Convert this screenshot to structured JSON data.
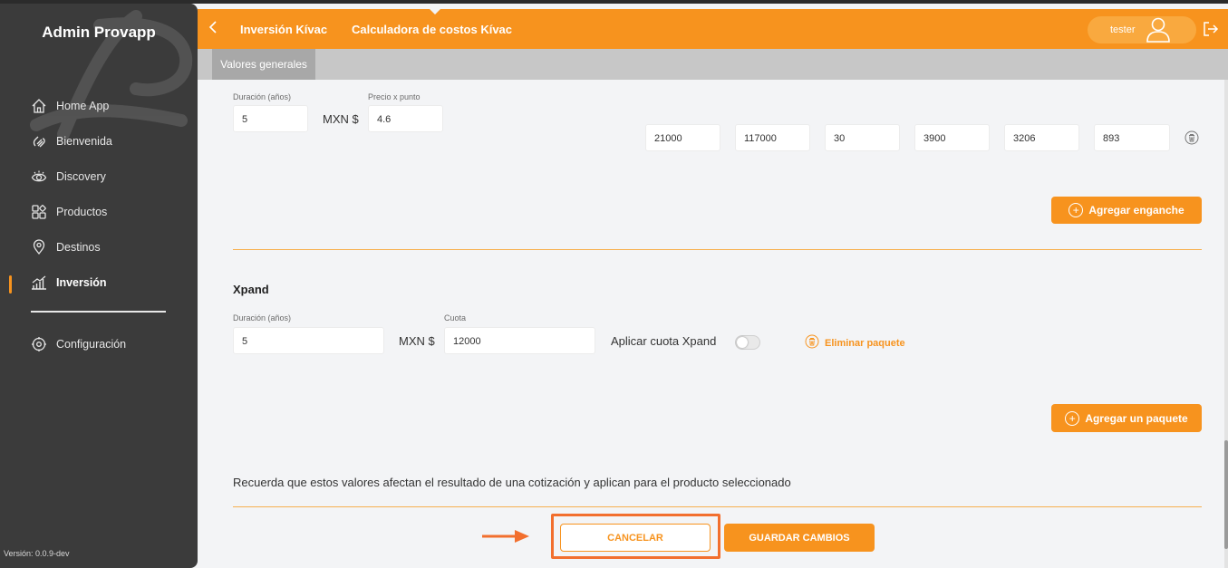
{
  "sidebar": {
    "brand": "Admin Provapp",
    "items": [
      {
        "label": "Home App",
        "icon": "home-icon"
      },
      {
        "label": "Bienvenida",
        "icon": "wave-hand-icon"
      },
      {
        "label": "Discovery",
        "icon": "eye-icon"
      },
      {
        "label": "Productos",
        "icon": "grid-icon"
      },
      {
        "label": "Destinos",
        "icon": "location-pin-icon"
      },
      {
        "label": "Inversión",
        "icon": "bar-chart-icon",
        "active": true
      }
    ],
    "settings": {
      "label": "Configuración",
      "icon": "gear-icon"
    },
    "version": "Versión: 0.0.9-dev"
  },
  "header": {
    "back_icon": "chevron-left-icon",
    "crumb1": "Inversión Kívac",
    "crumb2": "Calculadora de costos Kívac",
    "user": "tester",
    "logout_icon": "logout-icon"
  },
  "tabs": [
    {
      "label": "Valores generales",
      "active": true
    }
  ],
  "package1": {
    "duration_label": "Duración (años)",
    "duration_value": "5",
    "currency": "MXN $",
    "price_label": "Precio x punto",
    "price_value": "4.6",
    "row_values": [
      "21000",
      "117000",
      "30",
      "3900",
      "3206",
      "893"
    ],
    "add_button": "Agregar enganche"
  },
  "package2": {
    "title": "Xpand",
    "duration_label": "Duración (años)",
    "duration_value": "5",
    "currency": "MXN $",
    "fee_label": "Cuota",
    "fee_value": "12000",
    "toggle_label": "Aplicar cuota Xpand",
    "toggle_on": false,
    "delete_label": "Eliminar paquete"
  },
  "add_package_button": "Agregar un paquete",
  "note": "Recuerda que estos valores afectan el resultado de una cotización y aplican para el producto seleccionado",
  "actions": {
    "cancel": "CANCELAR",
    "save": "GUARDAR CAMBIOS"
  },
  "colors": {
    "accent": "#f7931e",
    "sidebar": "#3b3b3b",
    "highlight": "#f26f2e"
  }
}
